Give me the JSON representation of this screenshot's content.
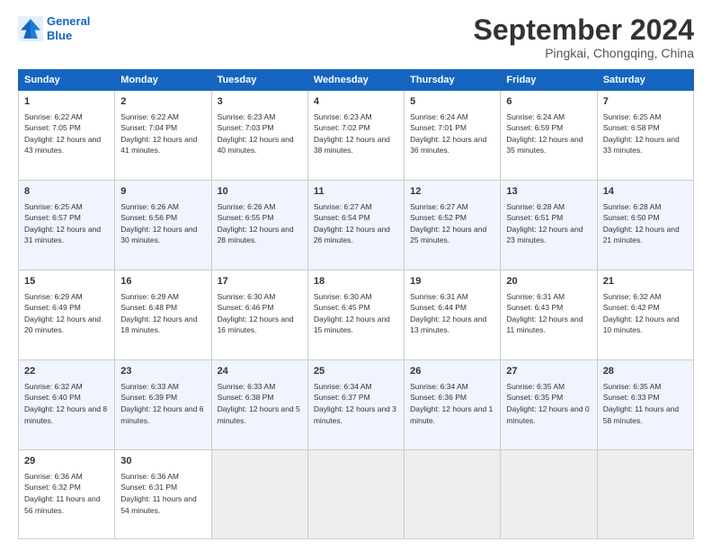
{
  "header": {
    "logo_line1": "General",
    "logo_line2": "Blue",
    "month": "September 2024",
    "location": "Pingkai, Chongqing, China"
  },
  "weekdays": [
    "Sunday",
    "Monday",
    "Tuesday",
    "Wednesday",
    "Thursday",
    "Friday",
    "Saturday"
  ],
  "rows": [
    [
      {
        "day": "1",
        "sunrise": "6:22 AM",
        "sunset": "7:05 PM",
        "daylight": "12 hours and 43 minutes."
      },
      {
        "day": "2",
        "sunrise": "6:22 AM",
        "sunset": "7:04 PM",
        "daylight": "12 hours and 41 minutes."
      },
      {
        "day": "3",
        "sunrise": "6:23 AM",
        "sunset": "7:03 PM",
        "daylight": "12 hours and 40 minutes."
      },
      {
        "day": "4",
        "sunrise": "6:23 AM",
        "sunset": "7:02 PM",
        "daylight": "12 hours and 38 minutes."
      },
      {
        "day": "5",
        "sunrise": "6:24 AM",
        "sunset": "7:01 PM",
        "daylight": "12 hours and 36 minutes."
      },
      {
        "day": "6",
        "sunrise": "6:24 AM",
        "sunset": "6:59 PM",
        "daylight": "12 hours and 35 minutes."
      },
      {
        "day": "7",
        "sunrise": "6:25 AM",
        "sunset": "6:58 PM",
        "daylight": "12 hours and 33 minutes."
      }
    ],
    [
      {
        "day": "8",
        "sunrise": "6:25 AM",
        "sunset": "6:57 PM",
        "daylight": "12 hours and 31 minutes."
      },
      {
        "day": "9",
        "sunrise": "6:26 AM",
        "sunset": "6:56 PM",
        "daylight": "12 hours and 30 minutes."
      },
      {
        "day": "10",
        "sunrise": "6:26 AM",
        "sunset": "6:55 PM",
        "daylight": "12 hours and 28 minutes."
      },
      {
        "day": "11",
        "sunrise": "6:27 AM",
        "sunset": "6:54 PM",
        "daylight": "12 hours and 26 minutes."
      },
      {
        "day": "12",
        "sunrise": "6:27 AM",
        "sunset": "6:52 PM",
        "daylight": "12 hours and 25 minutes."
      },
      {
        "day": "13",
        "sunrise": "6:28 AM",
        "sunset": "6:51 PM",
        "daylight": "12 hours and 23 minutes."
      },
      {
        "day": "14",
        "sunrise": "6:28 AM",
        "sunset": "6:50 PM",
        "daylight": "12 hours and 21 minutes."
      }
    ],
    [
      {
        "day": "15",
        "sunrise": "6:29 AM",
        "sunset": "6:49 PM",
        "daylight": "12 hours and 20 minutes."
      },
      {
        "day": "16",
        "sunrise": "6:29 AM",
        "sunset": "6:48 PM",
        "daylight": "12 hours and 18 minutes."
      },
      {
        "day": "17",
        "sunrise": "6:30 AM",
        "sunset": "6:46 PM",
        "daylight": "12 hours and 16 minutes."
      },
      {
        "day": "18",
        "sunrise": "6:30 AM",
        "sunset": "6:45 PM",
        "daylight": "12 hours and 15 minutes."
      },
      {
        "day": "19",
        "sunrise": "6:31 AM",
        "sunset": "6:44 PM",
        "daylight": "12 hours and 13 minutes."
      },
      {
        "day": "20",
        "sunrise": "6:31 AM",
        "sunset": "6:43 PM",
        "daylight": "12 hours and 11 minutes."
      },
      {
        "day": "21",
        "sunrise": "6:32 AM",
        "sunset": "6:42 PM",
        "daylight": "12 hours and 10 minutes."
      }
    ],
    [
      {
        "day": "22",
        "sunrise": "6:32 AM",
        "sunset": "6:40 PM",
        "daylight": "12 hours and 8 minutes."
      },
      {
        "day": "23",
        "sunrise": "6:33 AM",
        "sunset": "6:39 PM",
        "daylight": "12 hours and 6 minutes."
      },
      {
        "day": "24",
        "sunrise": "6:33 AM",
        "sunset": "6:38 PM",
        "daylight": "12 hours and 5 minutes."
      },
      {
        "day": "25",
        "sunrise": "6:34 AM",
        "sunset": "6:37 PM",
        "daylight": "12 hours and 3 minutes."
      },
      {
        "day": "26",
        "sunrise": "6:34 AM",
        "sunset": "6:36 PM",
        "daylight": "12 hours and 1 minute."
      },
      {
        "day": "27",
        "sunrise": "6:35 AM",
        "sunset": "6:35 PM",
        "daylight": "12 hours and 0 minutes."
      },
      {
        "day": "28",
        "sunrise": "6:35 AM",
        "sunset": "6:33 PM",
        "daylight": "11 hours and 58 minutes."
      }
    ],
    [
      {
        "day": "29",
        "sunrise": "6:36 AM",
        "sunset": "6:32 PM",
        "daylight": "11 hours and 56 minutes."
      },
      {
        "day": "30",
        "sunrise": "6:36 AM",
        "sunset": "6:31 PM",
        "daylight": "11 hours and 54 minutes."
      },
      null,
      null,
      null,
      null,
      null
    ]
  ],
  "labels": {
    "sunrise": "Sunrise:",
    "sunset": "Sunset:",
    "daylight": "Daylight:"
  }
}
